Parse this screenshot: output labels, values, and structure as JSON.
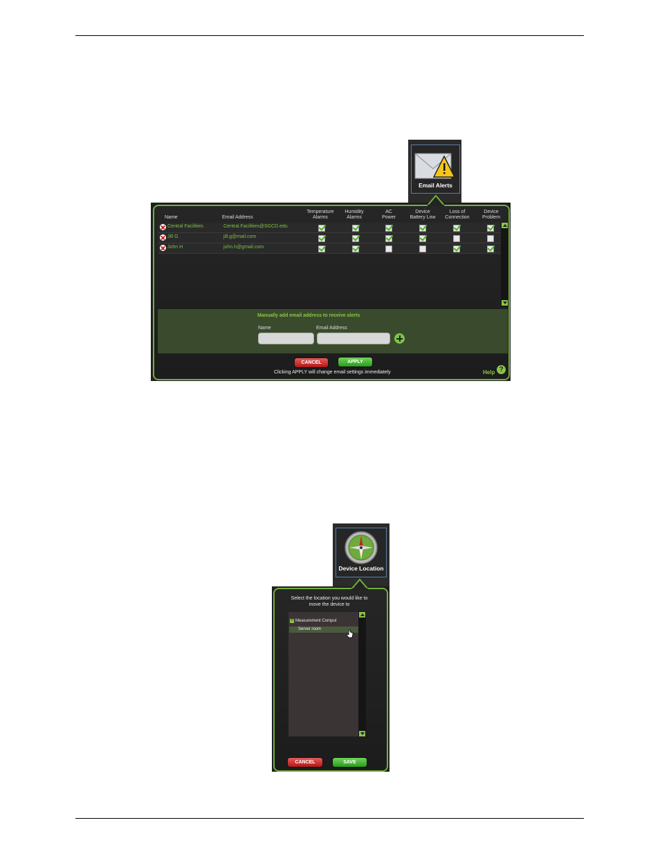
{
  "email_alerts": {
    "tile_label": "Email Alerts",
    "columns": {
      "name": "Name",
      "email": "Email Address",
      "temp": [
        "Temperature",
        "Alarms"
      ],
      "humidity": [
        "Humidity",
        "Alarms"
      ],
      "ac": [
        "AC",
        "Power"
      ],
      "battery": [
        "Device",
        "Battery Low"
      ],
      "loss": [
        "Loss of",
        "Connection"
      ],
      "problem": [
        "Device",
        "Problem"
      ]
    },
    "rows": [
      {
        "name": "Central Facilities",
        "email": "Central.Facilities@SGCD.edu",
        "checks": [
          true,
          true,
          true,
          true,
          true,
          true
        ]
      },
      {
        "name": "Jill G",
        "email": "jill.g@mail.com",
        "checks": [
          true,
          true,
          true,
          true,
          false,
          false
        ]
      },
      {
        "name": "John H",
        "email": "john.h@gmail.com",
        "checks": [
          true,
          true,
          false,
          false,
          true,
          true
        ]
      }
    ],
    "add_section": {
      "title": "Manually add email address to receive alerts",
      "name_label": "Name",
      "email_label": "Email Address"
    },
    "cancel_label": "CANCEL",
    "apply_label": "APPLY",
    "note": "Clicking APPLY will change email settings immediately",
    "help_label": "Help",
    "help_icon_glyph": "?"
  },
  "device_location": {
    "tile_label": "Device Location",
    "prompt": "Select the location you would like to move the device to",
    "tree": {
      "root": "Measurement Comput",
      "child": "Server room",
      "collapse_glyph": "−"
    },
    "cancel_label": "CANCEL",
    "save_label": "SAVE"
  },
  "colors": {
    "accent_green": "#6fb23b",
    "link_green": "#7cc443",
    "cancel_red": "#c82323",
    "panel_dark": "#1f1f1f"
  }
}
